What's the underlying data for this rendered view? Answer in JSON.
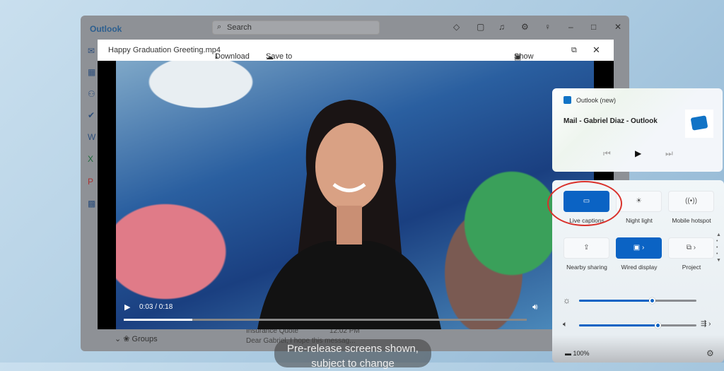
{
  "outlook": {
    "title": "Outlook",
    "search_placeholder": "Search",
    "titlebar_icons": [
      "diamond-icon",
      "notes-icon",
      "bell-icon",
      "gear-icon",
      "lightbulb-icon"
    ],
    "rail_icons": [
      "mail-icon",
      "calendar-icon",
      "people-icon",
      "todo-icon",
      "word-icon",
      "excel-icon",
      "powerpoint-icon",
      "apps-icon"
    ],
    "groups_label": "Groups",
    "message": {
      "subject": "Insurance Quote",
      "time": "12:02 PM",
      "preview": "Dear Gabriel, I hope this messag..."
    }
  },
  "viewer": {
    "filename": "Happy Graduation Greeting.mp4",
    "download": "Download",
    "save_onedrive": "Save to OneDrive",
    "show_email": "Show email",
    "time": "0:03 / 0:18",
    "progress_percent": 17
  },
  "caption": "Pre-release screens shown, subject to change",
  "quick_settings": {
    "media": {
      "app": "Outlook (new)",
      "title": "Mail - Gabriel Diaz - Outlook"
    },
    "tiles": [
      {
        "label": "Live captions",
        "active": true,
        "icon": "captions-icon"
      },
      {
        "label": "Night light",
        "active": false,
        "icon": "night-light-icon"
      },
      {
        "label": "Mobile hotspot",
        "active": false,
        "icon": "hotspot-icon"
      },
      {
        "label": "Nearby sharing",
        "active": false,
        "icon": "share-icon"
      },
      {
        "label": "Wired display",
        "active": true,
        "icon": "display-icon"
      },
      {
        "label": "Project",
        "active": false,
        "icon": "project-icon"
      }
    ],
    "brightness_percent": 62,
    "volume_percent": 67,
    "battery": "100%"
  },
  "colors": {
    "accent": "#0b63c4",
    "highlight_ring": "#d9312b"
  }
}
